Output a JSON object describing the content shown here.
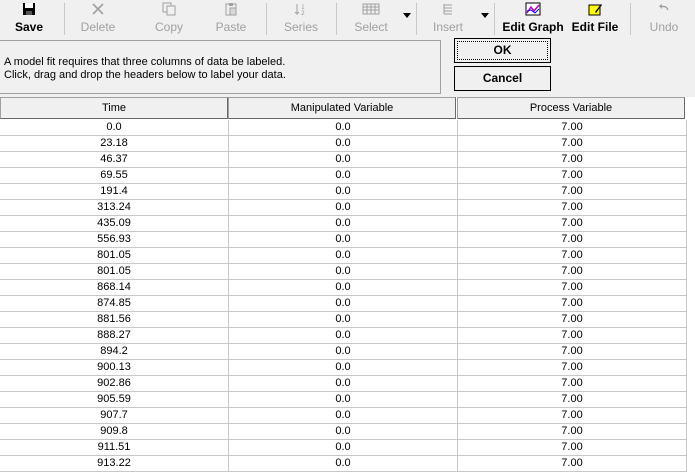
{
  "toolbar": {
    "save": "Save",
    "delete": "Delete",
    "copy": "Copy",
    "paste": "Paste",
    "series": "Series",
    "select": "Select",
    "insert": "Insert",
    "edit_graph": "Edit Graph",
    "edit_file": "Edit File",
    "undo": "Undo"
  },
  "info": {
    "line1": "A model fit requires that three columns of data be labeled.",
    "line2": "Click, drag and drop the headers below to label your data."
  },
  "dialog": {
    "ok": "OK",
    "cancel": "Cancel"
  },
  "grid": {
    "headers": [
      "Time",
      "Manipulated Variable",
      "Process Variable"
    ],
    "rows": [
      [
        "0.0",
        "0.0",
        "7.00"
      ],
      [
        "23.18",
        "0.0",
        "7.00"
      ],
      [
        "46.37",
        "0.0",
        "7.00"
      ],
      [
        "69.55",
        "0.0",
        "7.00"
      ],
      [
        "191.4",
        "0.0",
        "7.00"
      ],
      [
        "313.24",
        "0.0",
        "7.00"
      ],
      [
        "435.09",
        "0.0",
        "7.00"
      ],
      [
        "556.93",
        "0.0",
        "7.00"
      ],
      [
        "801.05",
        "0.0",
        "7.00"
      ],
      [
        "801.05",
        "0.0",
        "7.00"
      ],
      [
        "868.14",
        "0.0",
        "7.00"
      ],
      [
        "874.85",
        "0.0",
        "7.00"
      ],
      [
        "881.56",
        "0.0",
        "7.00"
      ],
      [
        "888.27",
        "0.0",
        "7.00"
      ],
      [
        "894.2",
        "0.0",
        "7.00"
      ],
      [
        "900.13",
        "0.0",
        "7.00"
      ],
      [
        "902.86",
        "0.0",
        "7.00"
      ],
      [
        "905.59",
        "0.0",
        "7.00"
      ],
      [
        "907.7",
        "0.0",
        "7.00"
      ],
      [
        "909.8",
        "0.0",
        "7.00"
      ],
      [
        "911.51",
        "0.0",
        "7.00"
      ],
      [
        "913.22",
        "0.0",
        "7.00"
      ]
    ]
  }
}
